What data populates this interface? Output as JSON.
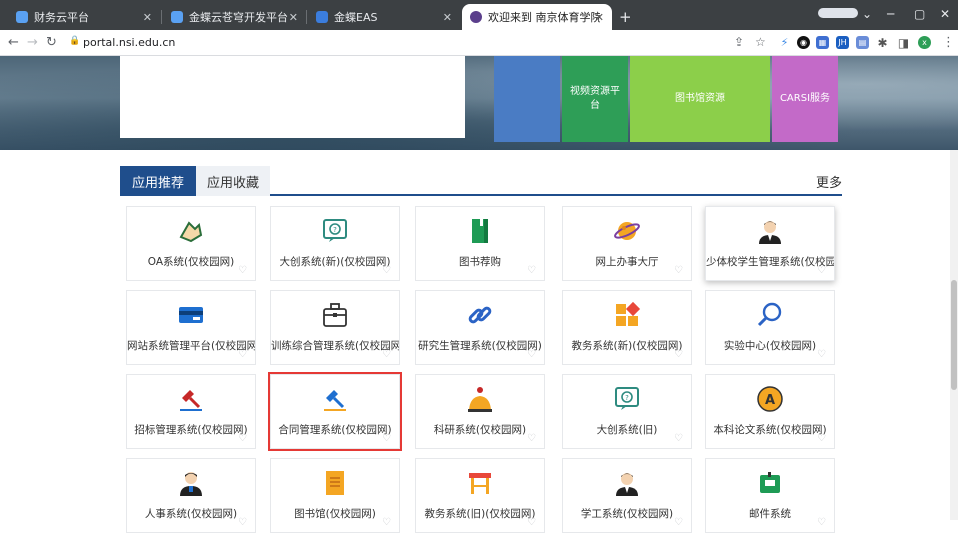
{
  "browser": {
    "tabs": [
      {
        "title": "财务云平台",
        "favicon_color": "#5aa1f2"
      },
      {
        "title": "金蝶云苍穹开发平台",
        "favicon_color": "#5aa1f2"
      },
      {
        "title": "金蝶EAS",
        "favicon_color": "#3b7ddd"
      },
      {
        "title": "欢迎来到 南京体育学院 | 融合门户",
        "favicon_color": "#5b3f8c"
      }
    ],
    "url": "portal.nsi.edu.cn",
    "extension_badge": "x"
  },
  "banner_tiles": [
    {
      "label": "",
      "color": "#4a7cc4"
    },
    {
      "label": "视频资源平台",
      "color": "#2e9e57"
    },
    {
      "label": "图书馆资源",
      "color": "#8ccf4a"
    },
    {
      "label": "CARSI服务",
      "color": "#c36ac8"
    }
  ],
  "section": {
    "tab_active": "应用推荐",
    "tab_inactive": "应用收藏",
    "more": "更多"
  },
  "apps": [
    {
      "label": "OA系统(仅校园网)",
      "icon": "handshake-icon"
    },
    {
      "label": "大创系统(新)(仅校园网)",
      "icon": "question-screen-icon"
    },
    {
      "label": "图书荐购",
      "icon": "book-icon"
    },
    {
      "label": "网上办事大厅",
      "icon": "planet-icon"
    },
    {
      "label": "少体校学生管理系统(仅校园",
      "icon": "student-icon"
    },
    {
      "label": "网站系统管理平台(仅校园网",
      "icon": "card-icon"
    },
    {
      "label": "训练综合管理系统(仅校园网",
      "icon": "briefcase-icon"
    },
    {
      "label": "研究生管理系统(仅校园网)",
      "icon": "link-icon"
    },
    {
      "label": "教务系统(新)(仅校园网)",
      "icon": "blocks-icon"
    },
    {
      "label": "实验中心(仅校园网)",
      "icon": "magnifier-icon"
    },
    {
      "label": "招标管理系统(仅校园网)",
      "icon": "gavel-red-icon"
    },
    {
      "label": "合同管理系统(仅校园网)",
      "icon": "gavel-blue-icon"
    },
    {
      "label": "科研系统(仅校园网)",
      "icon": "bell-icon"
    },
    {
      "label": "大创系统(旧)",
      "icon": "question-screen-icon"
    },
    {
      "label": "本科论文系统(仅校园网)",
      "icon": "letter-a-icon"
    },
    {
      "label": "人事系统(仅校园网)",
      "icon": "person-icon"
    },
    {
      "label": "图书馆(仅校园网)",
      "icon": "scroll-icon"
    },
    {
      "label": "教务系统(旧)(仅校园网)",
      "icon": "desk-icon"
    },
    {
      "label": "学工系统(仅校园网)",
      "icon": "student-icon"
    },
    {
      "label": "邮件系统",
      "icon": "mailbox-icon"
    }
  ],
  "favorite_glyph": "♡"
}
